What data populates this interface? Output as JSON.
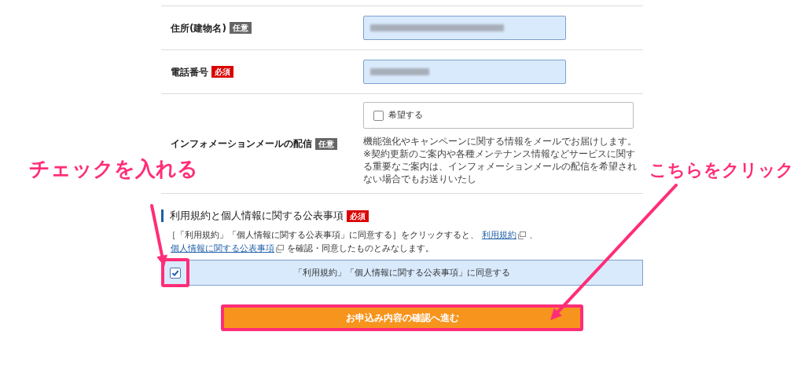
{
  "fields": [
    {
      "label": "住所(建物名)",
      "badge": {
        "text": "任意",
        "kind": "optional"
      },
      "kind": "input"
    },
    {
      "label": "電話番号",
      "badge": {
        "text": "必須",
        "kind": "required"
      },
      "kind": "input"
    },
    {
      "label": "インフォメーションメールの配信",
      "badge": {
        "text": "任意",
        "kind": "optional"
      },
      "kind": "checkbox",
      "option": {
        "label": "希望する",
        "checked": false
      },
      "notes": [
        "機能強化やキャンペーンに関する情報をメールでお届けします。",
        "※契約更新のご案内や各種メンテナンス情報などサービスに関する重要なご案内は、インフォメーションメールの配信を希望されない場合でもお送りいたし"
      ]
    }
  ],
  "terms": {
    "title": "利用規約と個人情報に関する公表事項",
    "badge": {
      "text": "必須",
      "kind": "required"
    },
    "description": [
      {
        "text": "［「利用規約」「個人情報に関する公表事項」に同意する］をクリックすると、",
        "kind": "text"
      },
      {
        "text": "利用規約",
        "kind": "link"
      },
      {
        "text": "、",
        "kind": "text"
      },
      {
        "text": "個人情報に関する公表事項",
        "kind": "link"
      },
      {
        "text": "を確認・同意したものとみなします。",
        "kind": "text"
      }
    ],
    "agree": {
      "label": "「利用規約」「個人情報に関する公表事項」に同意する",
      "checked": true
    }
  },
  "submit": "お申込み内容の確認へ進む",
  "annotations": [
    {
      "text": "チェックを入れる"
    },
    {
      "text": "こちらをクリック"
    }
  ]
}
